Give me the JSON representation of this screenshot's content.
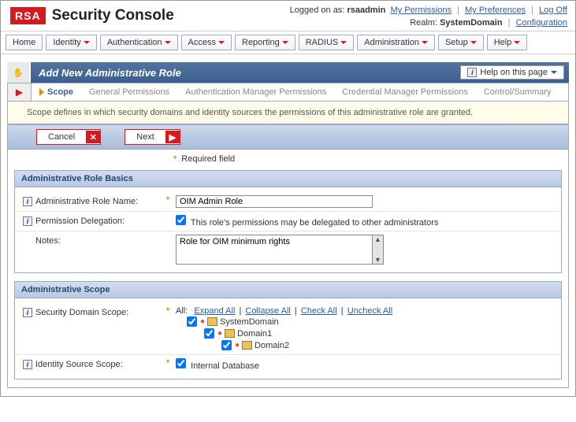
{
  "header": {
    "brand_short": "RSA",
    "brand_title": "Security Console",
    "logged_label": "Logged on as:",
    "logged_user": "rsaadmin",
    "links": {
      "perms": "My Permissions",
      "prefs": "My Preferences",
      "logoff": "Log Off"
    },
    "realm_label": "Realm:",
    "realm_value": "SystemDomain",
    "config_link": "Configuration"
  },
  "menu": [
    "Home",
    "Identity",
    "Authentication",
    "Access",
    "Reporting",
    "RADIUS",
    "Administration",
    "Setup",
    "Help"
  ],
  "wizard": {
    "title": "Add New Administrative Role",
    "help_btn": "Help on this page",
    "tabs": [
      "Scope",
      "General Permissions",
      "Authentication Manager Permissions",
      "Credential Manager Permissions",
      "Control/Summary"
    ],
    "active_tab": 0,
    "desc": "Scope defines in which security domains and identity sources the permissions of this administrative role are granted."
  },
  "buttons": {
    "cancel": "Cancel",
    "next": "Next"
  },
  "required_note": "Required field",
  "sections": {
    "basics": {
      "title": "Administrative Role Basics",
      "name_label": "Administrative Role Name:",
      "name_value": "OIM Admin Role",
      "delegation_label": "Permission Delegation:",
      "delegation_text": "This role's permissions may be delegated to other administrators",
      "notes_label": "Notes:",
      "notes_value": "Role for OIM minimum rights"
    },
    "scope": {
      "title": "Administrative Scope",
      "domain_label": "Security Domain Scope:",
      "all_label": "All:",
      "tree_links": {
        "expand": "Expand All",
        "collapse": "Collapse All",
        "check": "Check All",
        "uncheck": "Uncheck All"
      },
      "tree": [
        {
          "name": "SystemDomain",
          "level": 0,
          "checked": true
        },
        {
          "name": "Domain1",
          "level": 1,
          "checked": true
        },
        {
          "name": "Domain2",
          "level": 2,
          "checked": true
        }
      ],
      "identity_label": "Identity Source Scope:",
      "identity_value": "Internal Database"
    }
  }
}
